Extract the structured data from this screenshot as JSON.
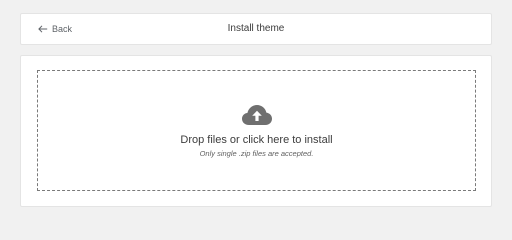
{
  "header": {
    "back_label": "Back",
    "title": "Install theme"
  },
  "dropzone": {
    "title": "Drop files or click here to install",
    "note": "Only single .zip files are accepted."
  },
  "icons": {
    "back": "arrow-left-icon",
    "upload": "cloud-upload-icon"
  },
  "colors": {
    "page_background": "#f1f1f1",
    "card_background": "#ffffff",
    "icon_gray": "#6f6f6f",
    "text_primary": "#3c3c3c",
    "dashed_border": "#7a7a7a"
  }
}
